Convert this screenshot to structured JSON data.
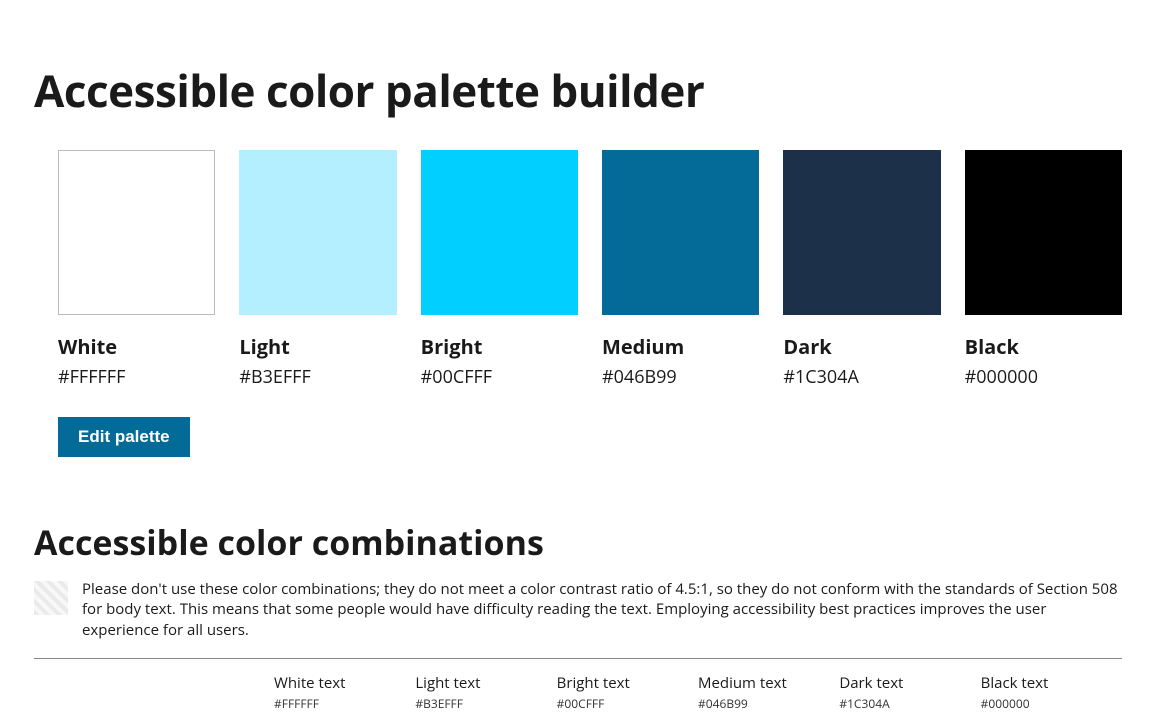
{
  "page": {
    "title": "Accessible color palette builder"
  },
  "palette": [
    {
      "label": "White",
      "hex": "#FFFFFF",
      "bg": "#FFFFFF",
      "border": true
    },
    {
      "label": "Light",
      "hex": "#B3EFFF",
      "bg": "#B3EFFF",
      "border": false
    },
    {
      "label": "Bright",
      "hex": "#00CFFF",
      "bg": "#00CFFF",
      "border": false
    },
    {
      "label": "Medium",
      "hex": "#046B99",
      "bg": "#046B99",
      "border": false
    },
    {
      "label": "Dark",
      "hex": "#1C304A",
      "bg": "#1C304A",
      "border": false
    },
    {
      "label": "Black",
      "hex": "#000000",
      "bg": "#000000",
      "border": false
    }
  ],
  "buttons": {
    "edit_palette": "Edit palette"
  },
  "combinations": {
    "heading": "Accessible color combinations",
    "note": "Please don't use these color combinations; they do not meet a color contrast ratio of 4.5:1, so they do not conform with the standards of Section 508 for body text. This means that some people would have difficulty reading the text. Employing accessibility best practices improves the user experience for all users.",
    "columns": [
      {
        "title": "White text",
        "hex": "#FFFFFF"
      },
      {
        "title": "Light text",
        "hex": "#B3EFFF"
      },
      {
        "title": "Bright text",
        "hex": "#00CFFF"
      },
      {
        "title": "Medium text",
        "hex": "#046B99"
      },
      {
        "title": "Dark text",
        "hex": "#1C304A"
      },
      {
        "title": "Black text",
        "hex": "#000000"
      }
    ]
  }
}
